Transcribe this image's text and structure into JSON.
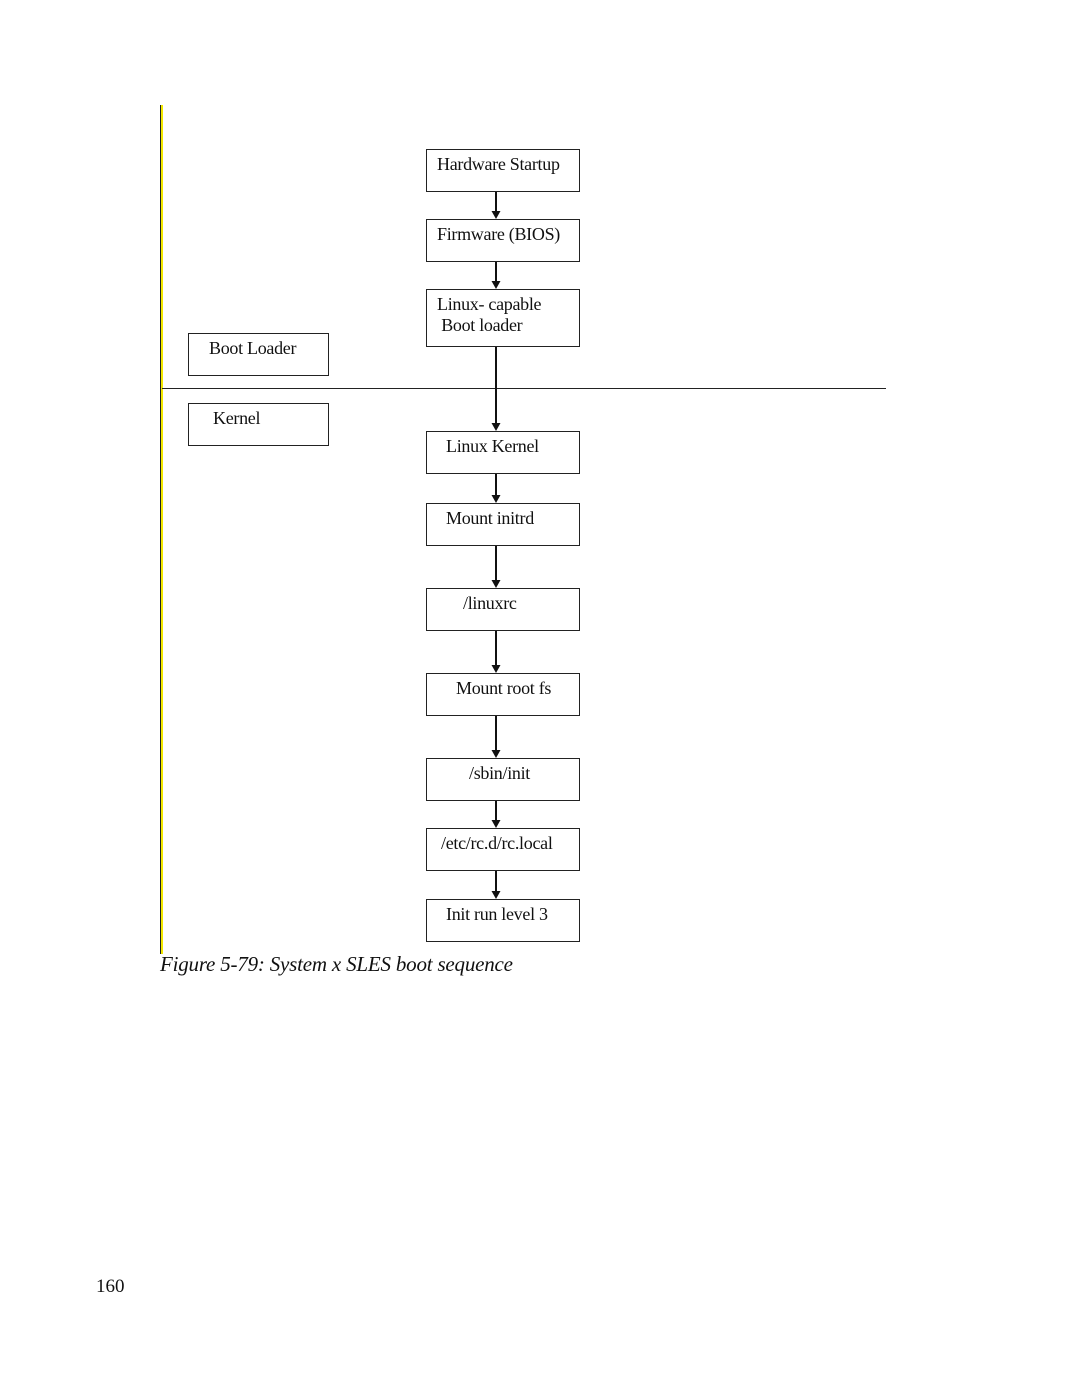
{
  "diagram": {
    "title": "System x SLES boot sequence",
    "phases": [
      {
        "id": "boot-loader",
        "label": "Boot Loader"
      },
      {
        "id": "kernel",
        "label": "Kernel"
      }
    ],
    "steps": [
      {
        "id": "hardware-startup",
        "label": "Hardware Startup",
        "phase": "boot-loader"
      },
      {
        "id": "firmware-bios",
        "label": "Firmware (BIOS)",
        "phase": "boot-loader"
      },
      {
        "id": "linux-capable-boot-loader",
        "label": "Linux- capable\n Boot loader",
        "phase": "boot-loader"
      },
      {
        "id": "linux-kernel",
        "label": "Linux Kernel",
        "phase": "kernel"
      },
      {
        "id": "mount-initrd",
        "label": "Mount initrd",
        "phase": "kernel"
      },
      {
        "id": "linuxrc",
        "label": "/linuxrc",
        "phase": "kernel"
      },
      {
        "id": "mount-root-fs",
        "label": "Mount root fs",
        "phase": "kernel"
      },
      {
        "id": "sbin-init",
        "label": "/sbin/init",
        "phase": "kernel"
      },
      {
        "id": "etc-rc-local",
        "label": "/etc/rc.d/rc.local",
        "phase": "kernel"
      },
      {
        "id": "init-run-level-3",
        "label": "Init run level 3",
        "phase": "kernel"
      }
    ],
    "edges": [
      [
        "hardware-startup",
        "firmware-bios"
      ],
      [
        "firmware-bios",
        "linux-capable-boot-loader"
      ],
      [
        "linux-capable-boot-loader",
        "linux-kernel"
      ],
      [
        "linux-kernel",
        "mount-initrd"
      ],
      [
        "mount-initrd",
        "linuxrc"
      ],
      [
        "linuxrc",
        "mount-root-fs"
      ],
      [
        "mount-root-fs",
        "sbin-init"
      ],
      [
        "sbin-init",
        "etc-rc-local"
      ],
      [
        "etc-rc-local",
        "init-run-level-3"
      ]
    ]
  },
  "caption": "Figure 5-79: System x SLES boot sequence",
  "page_number": "160"
}
